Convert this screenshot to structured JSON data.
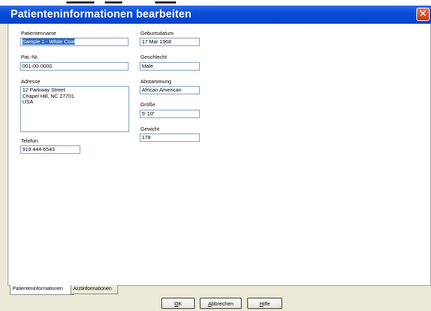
{
  "dialog": {
    "title": "Patienteninformationen bearbeiten",
    "close_glyph": "✕"
  },
  "fields": {
    "name": {
      "label": "Patientenname",
      "value": "Sample 1 - White Coat"
    },
    "patnr": {
      "label": "Pat.-Nr.",
      "value": "001-00-0000"
    },
    "adresse": {
      "label": "Adresse",
      "value": "12 Parkway Street\nChapel Hill, NC 27701\nUSA"
    },
    "telefon": {
      "label": "Telefon",
      "value": "919 444-6543"
    },
    "geburtsdatum": {
      "label": "Geburtsdatum",
      "value": "17 Mar 1968"
    },
    "geschlecht": {
      "label": "Geschlecht",
      "value": "Male"
    },
    "abstammung": {
      "label": "Abstammung",
      "value": "African American"
    },
    "groesse": {
      "label": "Größe",
      "value": "5' 10\""
    },
    "gewicht": {
      "label": "Gewicht",
      "value": "178"
    }
  },
  "tabs": [
    {
      "label": "Patienteninformationen"
    },
    {
      "label": "Arztinformationen"
    }
  ],
  "buttons": {
    "ok": {
      "accel": "O",
      "rest": "K"
    },
    "cancel": {
      "accel": "A",
      "rest": "bbrechen"
    },
    "help": {
      "accel": "H",
      "rest": "ilfe"
    }
  }
}
